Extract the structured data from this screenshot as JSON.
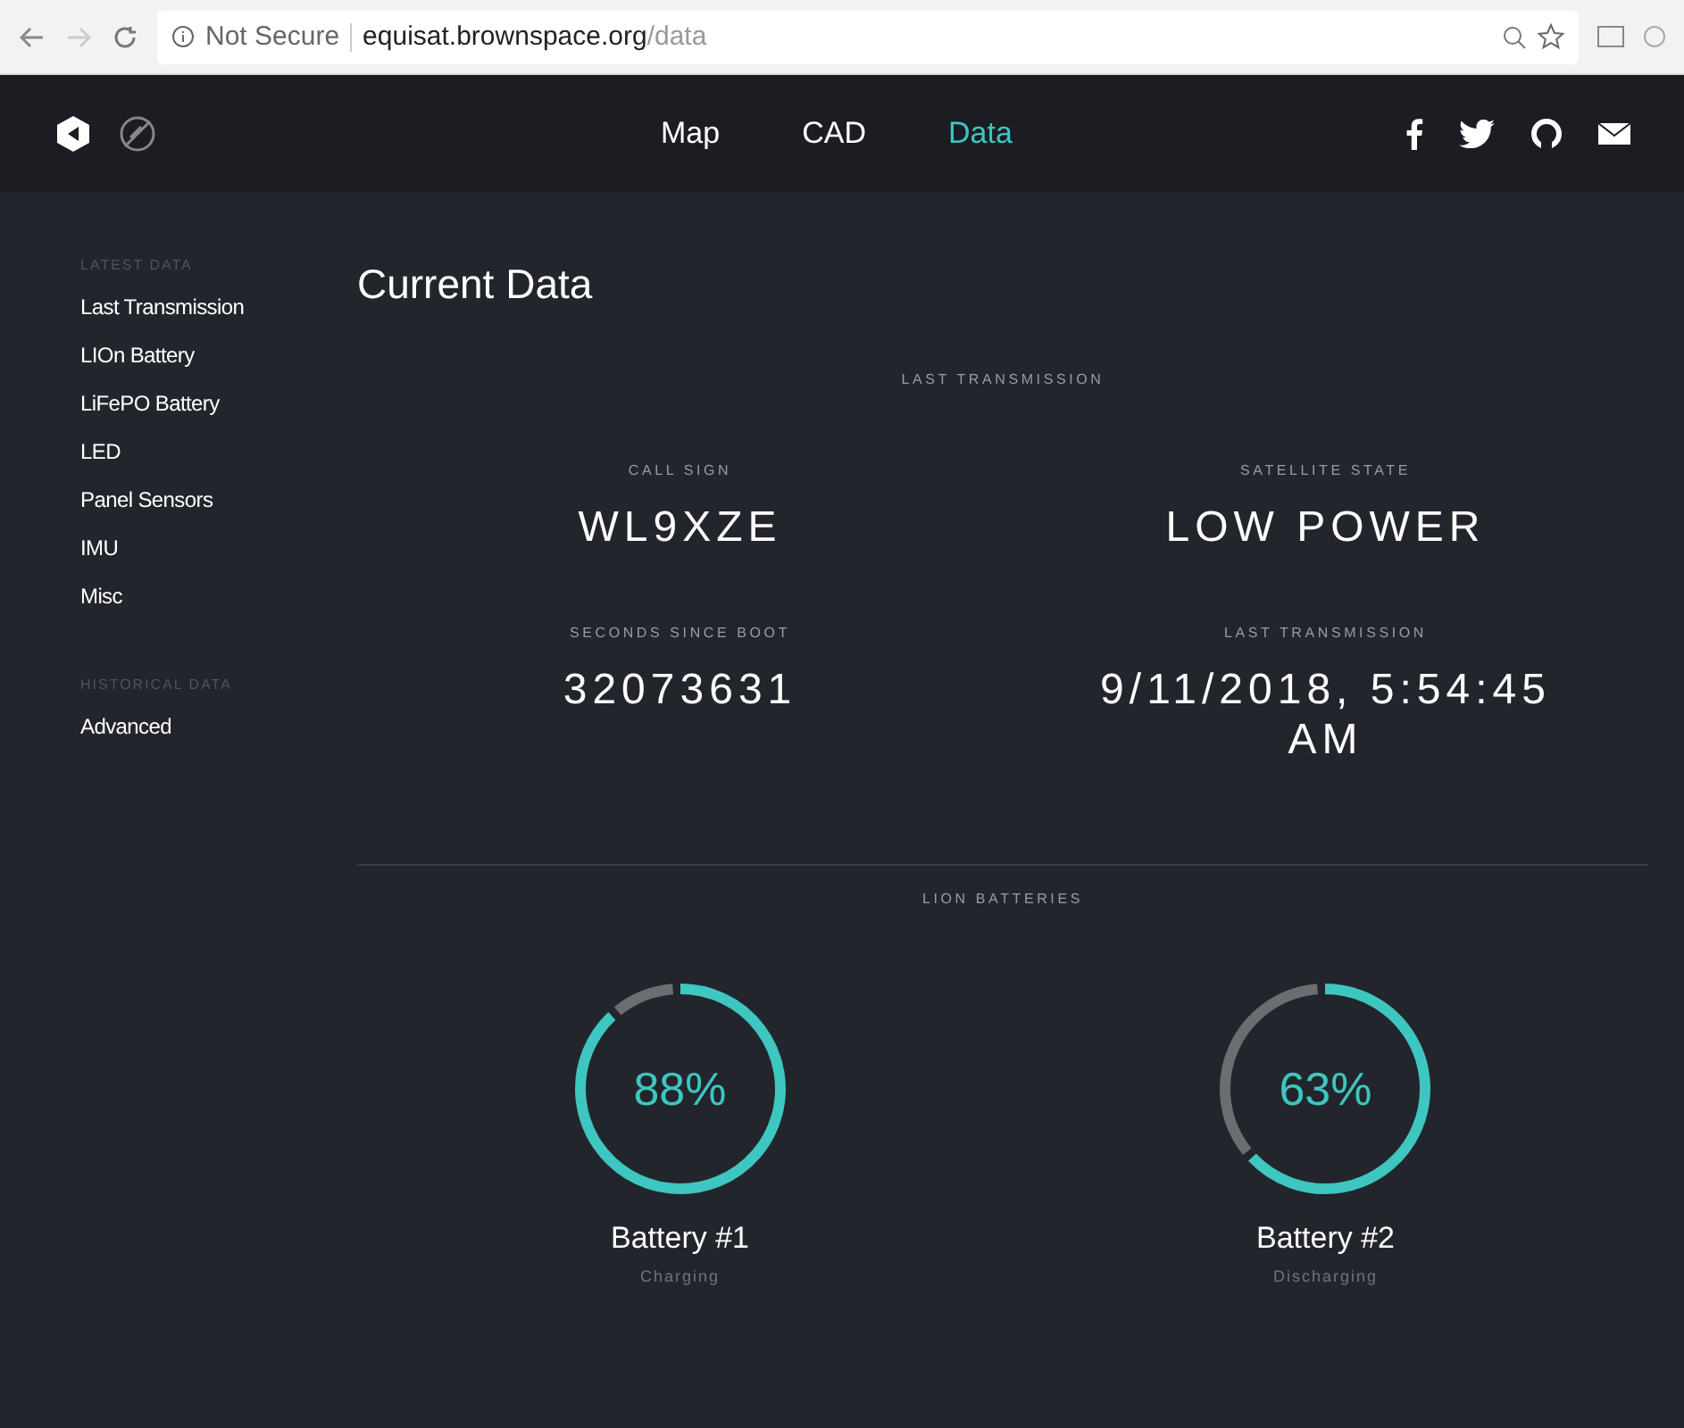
{
  "browser": {
    "security": "Not Secure",
    "url_host": "equisat.brownspace.org",
    "url_path": "/data"
  },
  "nav": {
    "links": [
      {
        "label": "Map",
        "selected": false
      },
      {
        "label": "CAD",
        "selected": false
      },
      {
        "label": "Data",
        "selected": true
      }
    ]
  },
  "sidebar": {
    "sections": [
      {
        "heading": "LATEST DATA",
        "items": [
          "Last Transmission",
          "LIOn Battery",
          "LiFePO Battery",
          "LED",
          "Panel Sensors",
          "IMU",
          "Misc"
        ]
      },
      {
        "heading": "HISTORICAL DATA",
        "items": [
          "Advanced"
        ]
      }
    ]
  },
  "page_title": "Current Data",
  "last_transmission": {
    "heading": "LAST TRANSMISSION",
    "fields": [
      {
        "label": "CALL SIGN",
        "value": "WL9XZE"
      },
      {
        "label": "SATELLITE STATE",
        "value": "LOW POWER"
      },
      {
        "label": "SECONDS SINCE BOOT",
        "value": "32073631"
      },
      {
        "label": "LAST TRANSMISSION",
        "value": "9/11/2018, 5:54:45 AM"
      }
    ]
  },
  "lion_batteries": {
    "heading": "LION BATTERIES",
    "batteries": [
      {
        "name": "Battery #1",
        "status": "Charging",
        "reading": "88%"
      },
      {
        "name": "Battery #2",
        "status": "Discharging",
        "reading": "63%"
      }
    ]
  }
}
